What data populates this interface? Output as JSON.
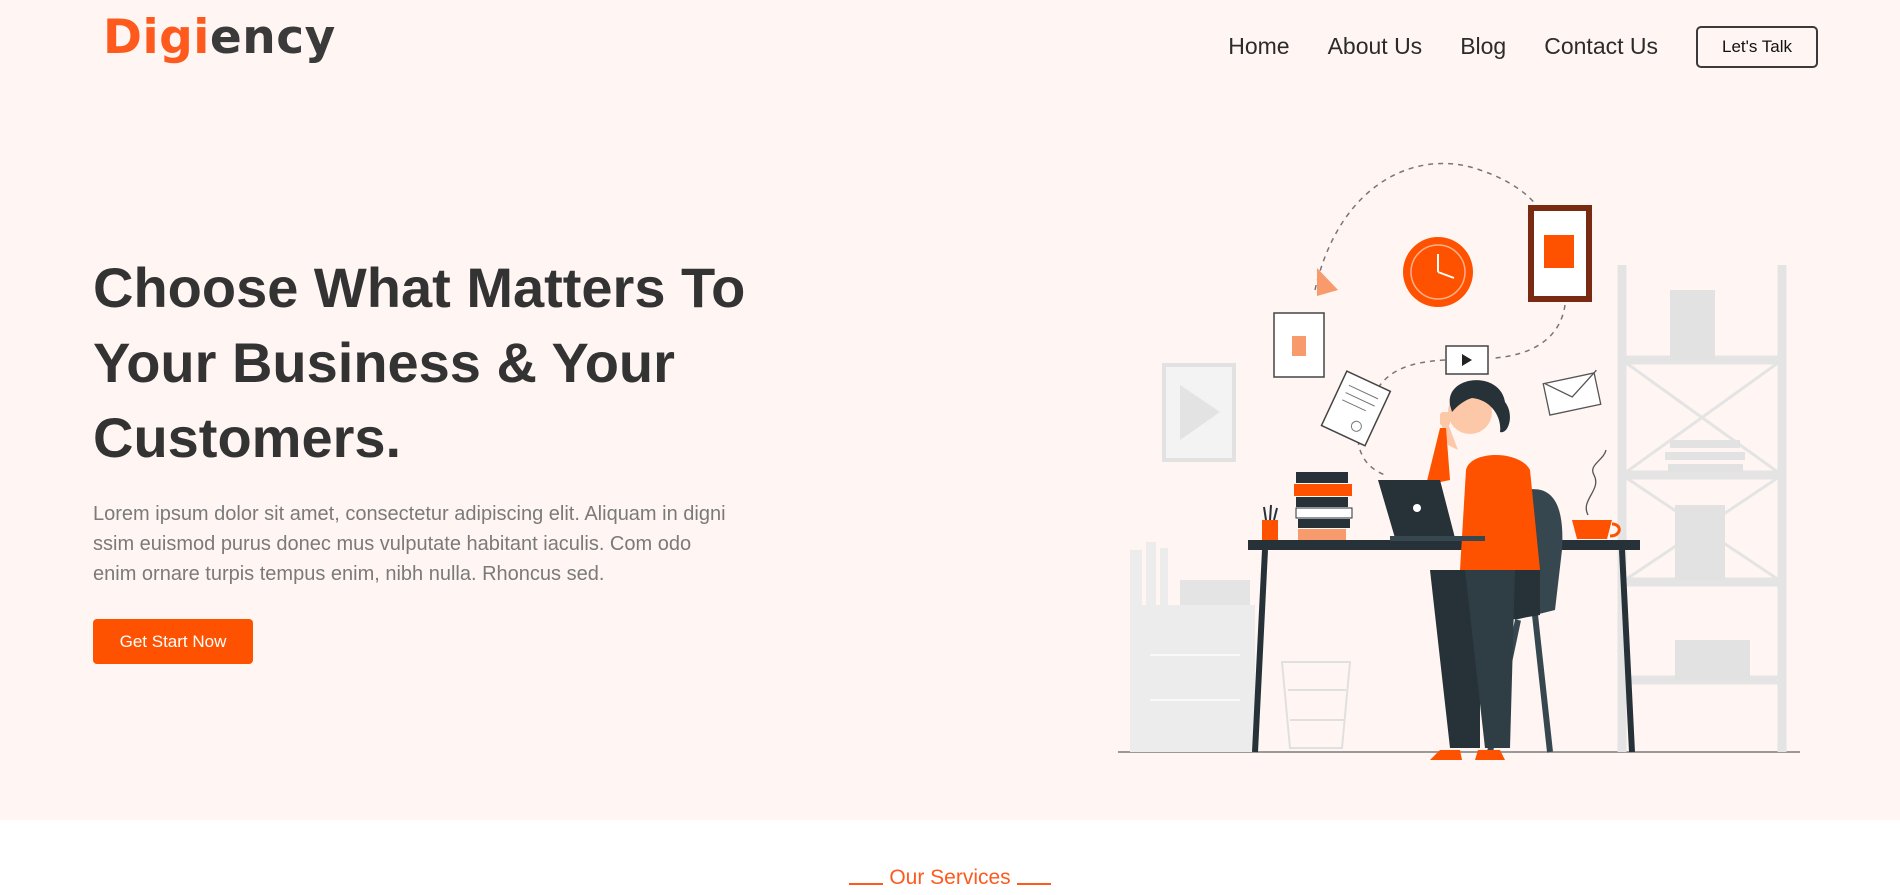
{
  "brand": {
    "part1": "Digi",
    "part2": "ency"
  },
  "nav": {
    "items": [
      "Home",
      "About Us",
      "Blog",
      "Contact Us"
    ],
    "cta_label": "Let's Talk"
  },
  "hero": {
    "headline_lines": [
      "Choose What Matters To",
      "Your Business & Your",
      "Customers."
    ],
    "description": "Lorem ipsum dolor sit amet, consectetur adipiscing elit. Aliquam in digni ssim euismod purus donec mus vulputate habitant iaculis. Com odo enim ornare turpis tempus enim, nibh nulla. Rhoncus sed.",
    "cta_label": "Get Start Now"
  },
  "services": {
    "label": "Our Services"
  },
  "colors": {
    "accent": "#fe5a1d",
    "hero_bg": "#fff5f2",
    "text_dark": "#333333"
  }
}
